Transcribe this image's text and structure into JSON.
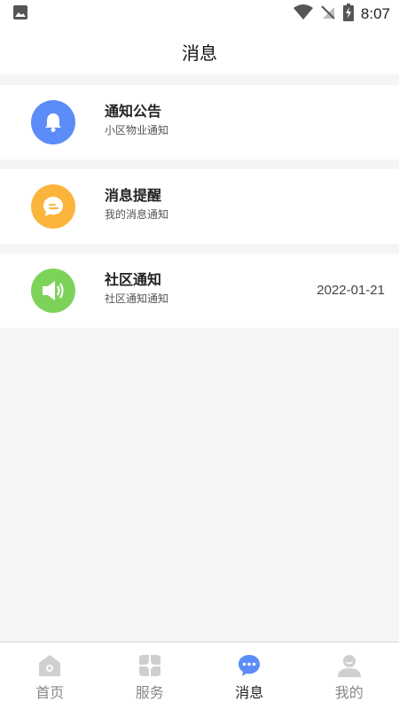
{
  "status_bar": {
    "time": "8:07",
    "icons": [
      "image-icon",
      "wifi-icon",
      "no-signal-icon",
      "battery-charging-icon"
    ]
  },
  "header": {
    "title": "消息"
  },
  "messages": [
    {
      "title": "通知公告",
      "subtitle": "小区物业通知",
      "date": "",
      "icon": "bell-icon",
      "color": "#5b8cf7"
    },
    {
      "title": "消息提醒",
      "subtitle": "我的消息通知",
      "date": "",
      "icon": "chat-bubble-icon",
      "color": "#fbb53c"
    },
    {
      "title": "社区通知",
      "subtitle": "社区通知通知",
      "date": "2022-01-21",
      "icon": "speaker-icon",
      "color": "#7dd35a"
    }
  ],
  "bottom_nav": {
    "items": [
      {
        "label": "首页",
        "icon": "home-icon",
        "active": false
      },
      {
        "label": "服务",
        "icon": "grid-icon",
        "active": false
      },
      {
        "label": "消息",
        "icon": "message-icon",
        "active": true
      },
      {
        "label": "我的",
        "icon": "user-icon",
        "active": false
      }
    ],
    "active_color": "#5b8cf7",
    "inactive_color": "#cfcfcf"
  }
}
